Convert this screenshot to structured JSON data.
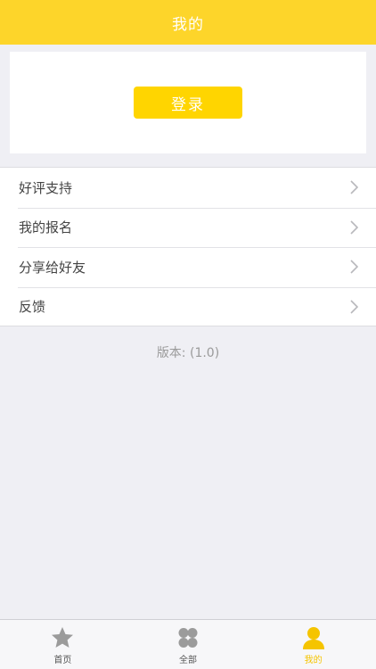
{
  "navbar": {
    "title": "我的"
  },
  "login": {
    "button_label": "登录"
  },
  "menu": {
    "items": [
      {
        "label": "好评支持",
        "icon": "chevron-right-icon"
      },
      {
        "label": "我的报名",
        "icon": "chevron-right-icon"
      },
      {
        "label": "分享给好友",
        "icon": "chevron-right-icon"
      },
      {
        "label": "反馈",
        "icon": "chevron-right-icon"
      }
    ]
  },
  "version": {
    "text": "版本: (1.0)"
  },
  "tabbar": {
    "tabs": [
      {
        "label": "首页",
        "icon": "star-icon",
        "active": false
      },
      {
        "label": "全部",
        "icon": "grid-icon",
        "active": false
      },
      {
        "label": "我的",
        "icon": "user-icon",
        "active": true
      }
    ]
  },
  "colors": {
    "accent": "#fdd52a",
    "button": "#ffd500",
    "background": "#efeff4",
    "active_tab": "#f5c400",
    "inactive_icon": "#9b9b9b"
  }
}
